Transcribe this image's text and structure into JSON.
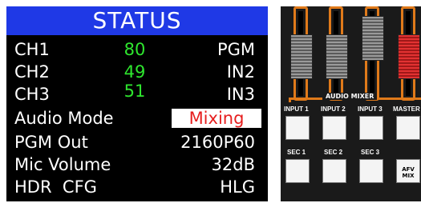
{
  "status": {
    "title": "STATUS",
    "rows": [
      {
        "label": "CH1",
        "level": "80",
        "value": "PGM"
      },
      {
        "label": "CH2",
        "level": "49",
        "value": "IN2"
      },
      {
        "label": "CH3",
        "level": "51",
        "value": "IN3"
      },
      {
        "label": "Audio Mode",
        "value": "Mixing"
      },
      {
        "label": "PGM Out",
        "value": "2160P60"
      },
      {
        "label": "Mic Volume",
        "value": "32dB"
      },
      {
        "label": "HDR  CFG",
        "value": "HLG"
      }
    ],
    "colors": {
      "header": "#1f39e6",
      "level": "#2ee62e",
      "mode": "#e61e1e"
    }
  },
  "mixer": {
    "title": "AUDIO MIXER",
    "fader_levels": [
      0.55,
      0.55,
      0.15,
      0.55
    ],
    "fader_colors": [
      "gray",
      "gray",
      "gray",
      "red"
    ],
    "row1": [
      "INPUT 1",
      "INPUT 2",
      "INPUT 3",
      "MASTER"
    ],
    "row2": [
      "SEC 1",
      "SEC 2",
      "SEC 3"
    ],
    "afv_button": "AFV\nMIX",
    "accent": "#e07a1a"
  }
}
